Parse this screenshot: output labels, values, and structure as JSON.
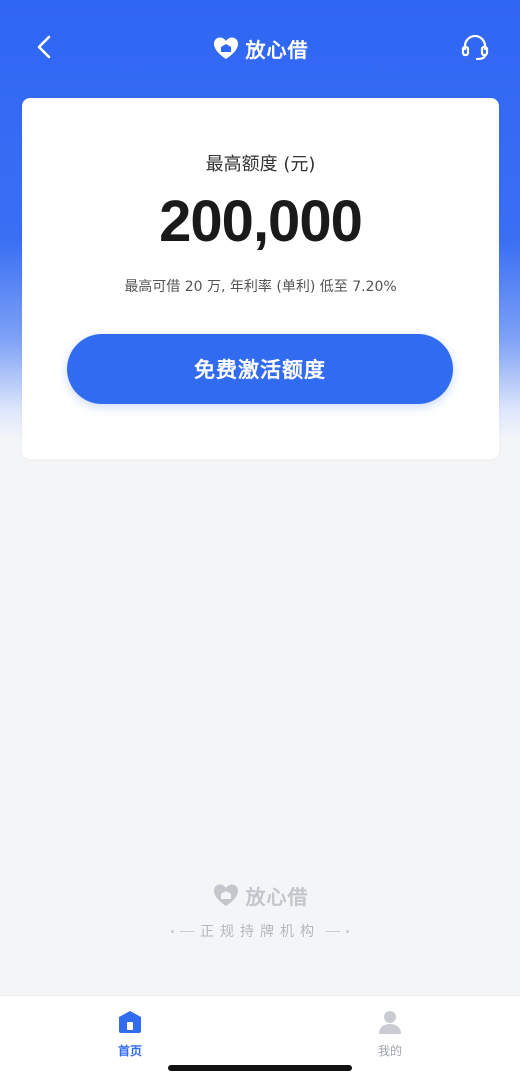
{
  "nav": {
    "brand_name": "放心借"
  },
  "card": {
    "label": "最高额度 (元)",
    "amount": "200,000",
    "description": "最高可借 20 万, 年利率 (单利) 低至 7.20%",
    "button_label": "免费激活额度"
  },
  "footer": {
    "brand_name": "放心借",
    "tagline": "正规持牌机构"
  },
  "tabs": [
    {
      "label": "首页",
      "icon": "home-icon",
      "active": true
    },
    {
      "label": "我的",
      "icon": "user-icon",
      "active": false
    }
  ],
  "colors": {
    "primary": "#316bef",
    "header_blue": "#2f66f3",
    "footer_gray": "#c4c6cc"
  }
}
